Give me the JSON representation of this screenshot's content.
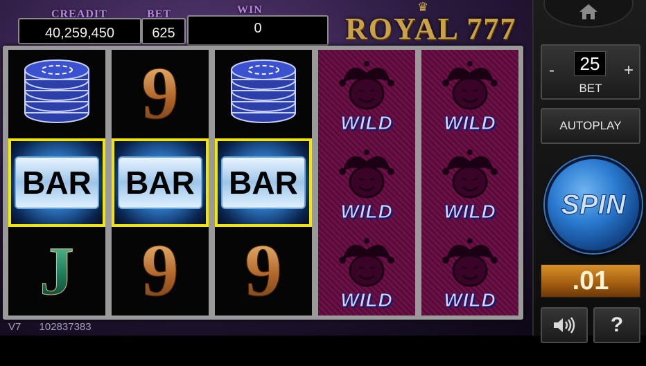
{
  "hud": {
    "credit_label": "CREADIT",
    "credit_value": "40,259,450",
    "bet_label": "BET",
    "bet_value": "625",
    "win_label": "WIN",
    "win_value": "0"
  },
  "brand": {
    "title": "ROYAL 777"
  },
  "reels": [
    [
      "chips",
      "bar",
      "J"
    ],
    [
      "9",
      "bar",
      "9"
    ],
    [
      "chips",
      "bar",
      "9"
    ],
    [
      "wild",
      "wild",
      "wild"
    ],
    [
      "wild",
      "wild",
      "wild"
    ]
  ],
  "symbols": {
    "bar_text": "BAR",
    "wild_text": "WILD",
    "nine": "9",
    "jack": "J"
  },
  "highlight_row": 1,
  "footer": {
    "version": "V7",
    "id": "102837383"
  },
  "controls": {
    "bet_value": "25",
    "bet_label": "BET",
    "minus": "-",
    "plus": "+",
    "autoplay_label": "AUTOPLAY",
    "spin_label": "SPIN",
    "denomination": ".01",
    "help_label": "?"
  },
  "icons": [
    "home-icon",
    "speaker-icon"
  ],
  "colors": {
    "highlight": "#f2e600",
    "wild_bg": "#5a0a3a",
    "spin_blue": "#2a7ad0",
    "denom_orange": "#d79028"
  }
}
